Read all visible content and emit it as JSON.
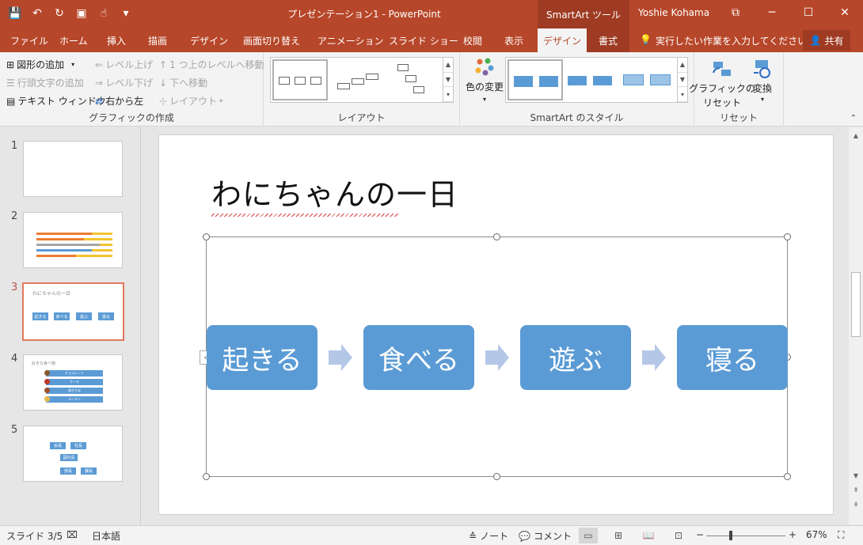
{
  "window": {
    "title": "プレゼンテーション1 - PowerPoint",
    "context_tools": "SmartArt ツール",
    "user": "Yoshie Kohama",
    "minimize": "─",
    "maximize": "☐",
    "close": "✕",
    "restore": "⧉"
  },
  "qat": {
    "save": "💾",
    "undo": "↶",
    "redo": "↻",
    "present": "▣",
    "touch": "☝",
    "more": "▾"
  },
  "tabs": [
    "ファイル",
    "ホーム",
    "挿入",
    "描画",
    "デザイン",
    "画面切り替え",
    "アニメーション",
    "スライド ショー",
    "校閲",
    "表示",
    "デザイン",
    "書式"
  ],
  "tell_me": "実行したい作業を入力してください",
  "share": "共有",
  "ribbon": {
    "create": {
      "add_shape": "図形の追加",
      "add_bullet": "行頭文字の追加",
      "text_pane": "テキスト ウィンドウ",
      "promote": "レベル上げ",
      "demote": "レベル下げ",
      "rtl": "右から左",
      "move_up": "1 つ上のレベルへ移動",
      "move_down": "下へ移動",
      "layout": "レイアウト",
      "label": "グラフィックの作成"
    },
    "layout_label": "レイアウト",
    "styles": {
      "change_colors": "色の変更",
      "label": "SmartArt のスタイル"
    },
    "reset": {
      "reset_graphic": "グラフィックの",
      "reset_graphic2": "リセット",
      "convert": "変換",
      "label": "リセット"
    }
  },
  "slides": [
    {
      "num": "1"
    },
    {
      "num": "2"
    },
    {
      "num": "3",
      "mini_title": "わにちゃんの一日",
      "mini_items": [
        "起きる",
        "食べる",
        "遊ぶ",
        "寝る"
      ]
    },
    {
      "num": "4",
      "mini_title": "好きな食べ物",
      "mini_items": [
        "チョコレート",
        "ケーキ",
        "焼きそば",
        "ラーメン"
      ]
    },
    {
      "num": "5",
      "mini_items": [
        "会長",
        "社長",
        "副社長",
        "部長",
        "課長"
      ]
    }
  ],
  "slide": {
    "title": "わにちゃんの一日",
    "items": [
      "起きる",
      "食べる",
      "遊ぶ",
      "寝る"
    ],
    "accent": "#5b9bd5",
    "arrow_color": "#b4c7e7"
  },
  "status": {
    "slide_info": "スライド 3/5",
    "language": "日本語",
    "notes": "ノート",
    "comments": "コメント",
    "zoom": "67%"
  }
}
